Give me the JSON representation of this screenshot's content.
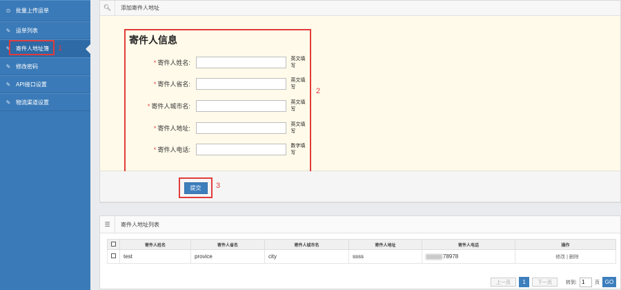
{
  "sidebar": {
    "items": [
      {
        "label": "批量上传运单",
        "icon": "upload-icon"
      },
      {
        "label": "运单列表",
        "icon": "pencil-icon"
      },
      {
        "label": "寄件人地址簿",
        "icon": "pencil-icon",
        "active": true
      },
      {
        "label": "修改密码",
        "icon": "pencil-icon"
      },
      {
        "label": "API接口设置",
        "icon": "pencil-icon"
      },
      {
        "label": "物流渠道设置",
        "icon": "pencil-icon"
      }
    ],
    "annotation": "1"
  },
  "form_panel": {
    "header": "添加寄件人地址",
    "title": "寄件人信息",
    "annotation": "2",
    "fields": [
      {
        "required": "*",
        "label": "寄件人姓名:",
        "hint": "英文填写",
        "value": ""
      },
      {
        "required": "*",
        "label": "寄件人省名:",
        "hint": "英文填写",
        "value": ""
      },
      {
        "required": "*",
        "label": "寄件人城市名:",
        "hint": "英文填写",
        "value": ""
      },
      {
        "required": "*",
        "label": "寄件人地址:",
        "hint": "英文填写",
        "value": ""
      },
      {
        "required": "*",
        "label": "寄件人电话:",
        "hint": "数字填写",
        "value": ""
      }
    ],
    "submit_label": "提交",
    "submit_annotation": "3"
  },
  "list_panel": {
    "header": "寄件人地址列表",
    "columns": [
      "寄件人姓名",
      "寄件人省名",
      "寄件人城市名",
      "寄件人地址",
      "寄件人电话",
      "操作"
    ],
    "rows": [
      {
        "name": "test",
        "province": "provice",
        "city": "city",
        "address": "ssss",
        "phone": "78978",
        "edit": "修改",
        "sep": "|",
        "delete": "删除"
      }
    ]
  },
  "pager": {
    "prev": "上一页",
    "current": "1",
    "next": "下一页",
    "goto_label": "转到:",
    "goto_value": "1",
    "page_suffix": "页",
    "go": "GO"
  },
  "colors": {
    "sidebar": "#3a7ab8",
    "accent": "#3d7ebd",
    "annotation_red": "#e23a3a",
    "form_bg": "#fffaea"
  }
}
